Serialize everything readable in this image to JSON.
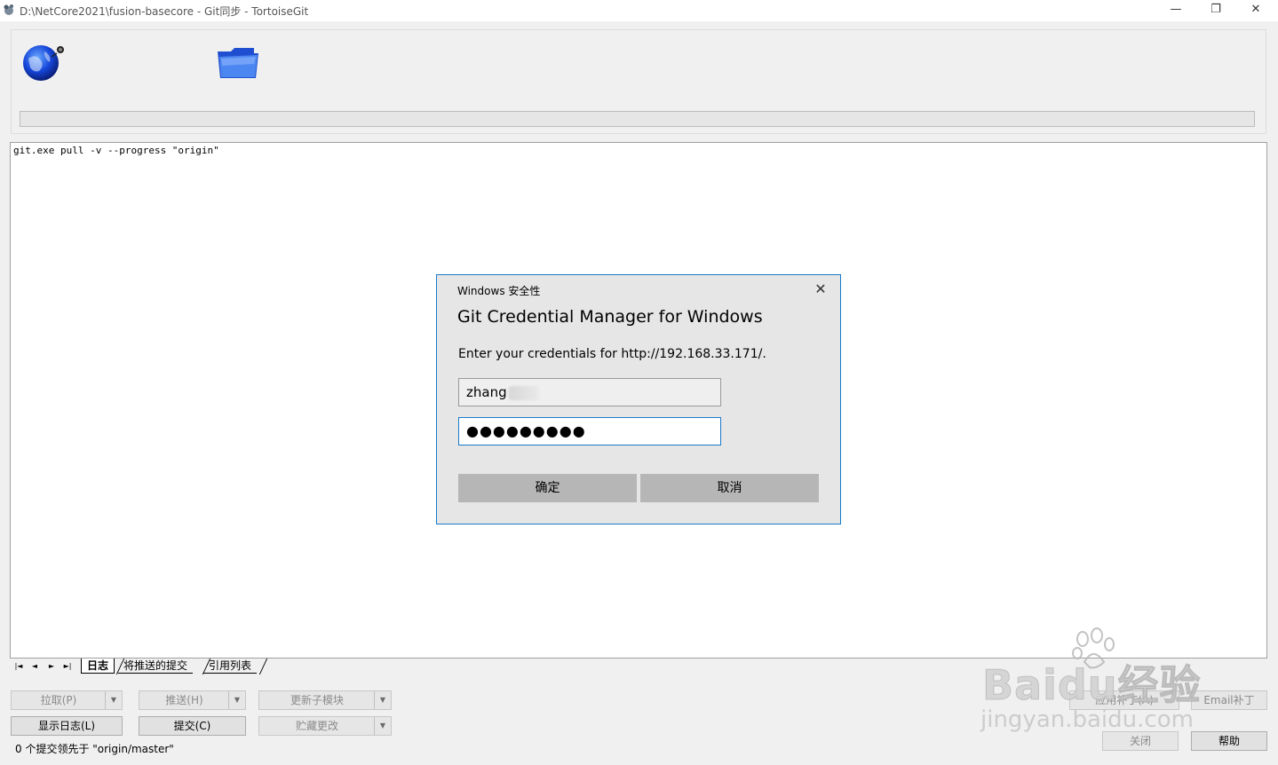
{
  "window": {
    "title": "D:\\NetCore2021\\fusion-basecore - Git同步 - TortoiseGit",
    "minimize_glyph": "—",
    "maximize_glyph": "❐",
    "close_glyph": "✕"
  },
  "toolbar": {
    "icons": [
      "globe-remote-icon",
      "folder-icon"
    ],
    "progress": 0
  },
  "log": {
    "lines": [
      "git.exe pull -v --progress \"origin\""
    ]
  },
  "tabs": {
    "nav_first": "|◄",
    "nav_prev": "◄",
    "nav_next": "►",
    "nav_last": "►|",
    "items": [
      {
        "label": "日志",
        "active": true
      },
      {
        "label": "将推送的提交",
        "active": false
      },
      {
        "label": "引用列表",
        "active": false
      }
    ]
  },
  "buttons": {
    "pull": "拉取(P)",
    "push": "推送(H)",
    "update_submodules": "更新子模块",
    "show_log": "显示日志(L)",
    "commit": "提交(C)",
    "stash": "贮藏更改",
    "apply_patch": "应用补丁(A)",
    "email_patch": "Email补丁",
    "close": "关闭",
    "help": "帮助",
    "dropdown_glyph": "▼"
  },
  "status": {
    "text": "0 个提交领先于 \"origin/master\""
  },
  "watermark": {
    "brand": "Baidu经验",
    "domain": "jingyan.baidu.com"
  },
  "dialog": {
    "caption": "Windows 安全性",
    "title": "Git Credential Manager for Windows",
    "message": "Enter your credentials for http://192.168.33.171/.",
    "username": "zhang",
    "password_mask": "●●●●●●●●●",
    "ok": "确定",
    "cancel": "取消",
    "close_glyph": "✕"
  },
  "colors": {
    "accent": "#1979ca",
    "background": "#f0f0f0",
    "dialog_bg": "#e6e6e6",
    "dialog_button": "#b6b6b6"
  }
}
